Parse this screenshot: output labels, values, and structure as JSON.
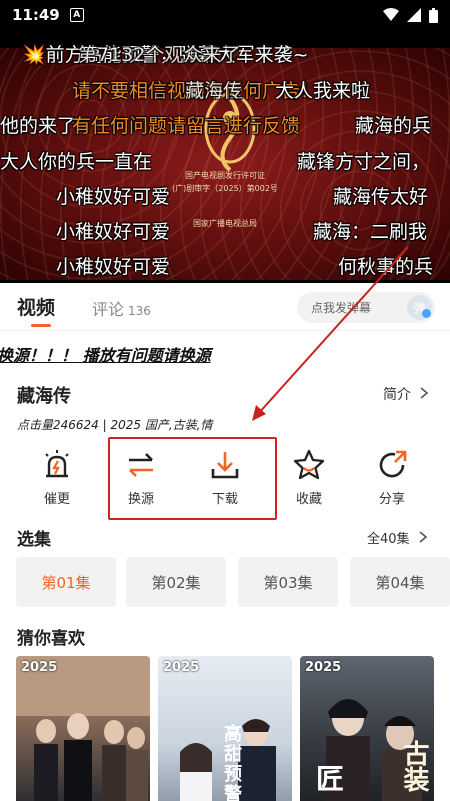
{
  "status": {
    "time": "11:49",
    "notif_letter": "A"
  },
  "video": {
    "danmaku": [
      {
        "text": "💥前方高能预警，弹幕大军来袭~",
        "color": "white"
      },
      {
        "text": "第7132个观众来了",
        "color": "white"
      },
      {
        "text": "请不要相信视频中任何广告！",
        "color": "orange"
      },
      {
        "text": "藏海传",
        "color": "white"
      },
      {
        "text": "大人我来啦",
        "color": "white"
      },
      {
        "text": "他的来了",
        "color": "white"
      },
      {
        "text": "有任何问题请留言进行反馈",
        "color": "orange"
      },
      {
        "text": "藏海的兵",
        "color": "white"
      },
      {
        "text": "大人你的兵一直在",
        "color": "white"
      },
      {
        "text": "藏锋方寸之间，",
        "color": "white"
      },
      {
        "text": "小稚奴好可爱",
        "color": "white"
      },
      {
        "text": "藏海传太好",
        "color": "white"
      },
      {
        "text": "小稚奴好可爱",
        "color": "white"
      },
      {
        "text": "藏海：二刷我",
        "color": "white"
      },
      {
        "text": "小稚奴好可爱",
        "color": "white"
      },
      {
        "text": "何秋事的兵",
        "color": "white"
      }
    ],
    "cert_lines": [
      "国产电视剧发行许可证",
      "(广)剧审字（2025）第002号",
      "国家广播电视总局"
    ]
  },
  "tabs": {
    "video_label": "视频",
    "comment_label": "评论",
    "comment_count": "136",
    "danmu_placeholder": "点我发弹幕",
    "danmu_toggle": "弹"
  },
  "notice": "换源！！！ 播放有问题请换源",
  "show": {
    "title": "藏海传",
    "intro_label": "简介",
    "meta": "点击量246624 | 2025 国产,古装,情"
  },
  "actions": [
    {
      "label": "催更",
      "icon": "alarm-icon"
    },
    {
      "label": "换源",
      "icon": "swap-icon"
    },
    {
      "label": "下载",
      "icon": "download-icon"
    },
    {
      "label": "收藏",
      "icon": "star-icon"
    },
    {
      "label": "分享",
      "icon": "share-icon"
    }
  ],
  "episodes": {
    "title": "选集",
    "all_label": "全40集",
    "items": [
      "第01集",
      "第02集",
      "第03集",
      "第04集"
    ]
  },
  "recommend": {
    "title": "猜你喜欢",
    "cards": [
      {
        "year": "2025"
      },
      {
        "year": "2025",
        "overlay": "高甜预警"
      },
      {
        "year": "2025",
        "overlay_a": "匠",
        "overlay_b": "古装"
      }
    ]
  },
  "colors": {
    "accent": "#f26522",
    "highlight_red": "#d42020",
    "danmaku_orange": "#f08a24"
  }
}
